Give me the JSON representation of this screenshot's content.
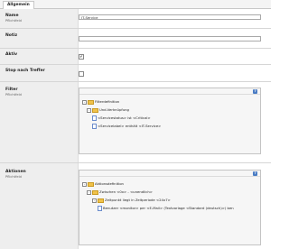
{
  "tabs": [
    {
      "label": "Allgemein"
    }
  ],
  "fields": {
    "name": {
      "label": "Name",
      "sub": "Pflichtfeld",
      "value": "IT-Service"
    },
    "notiz": {
      "label": "Notiz",
      "value": ""
    },
    "aktiv": {
      "label": "Aktiv",
      "checked": true,
      "check_glyph": "✔"
    },
    "stop": {
      "label": "Stop nach Treffer",
      "checked": false
    },
    "filter": {
      "label": "Filter",
      "sub": "Pflichtfeld",
      "tree": {
        "root": "Filterdefinition",
        "group": "Und-Verknüpfung",
        "items": [
          "<Servicestatus> ist <Critical>",
          "<Servicelabel> enthält <IT-Service>"
        ]
      }
    },
    "aktionen": {
      "label": "Aktionen",
      "sub": "Pflichtfeld",
      "tree": {
        "root": "Aktionsdefinition",
        "level1": "Zwischen <0x> - <unendlich>",
        "level2": "Zeitpunkt liegt in Zeitperiode <24x7>",
        "level3": "Benutzer <monitor> per <E-Mail> (Textvorlage <Standard (deutsch)>) ben"
      }
    }
  },
  "icons": {
    "help": "?",
    "expand": "-"
  }
}
